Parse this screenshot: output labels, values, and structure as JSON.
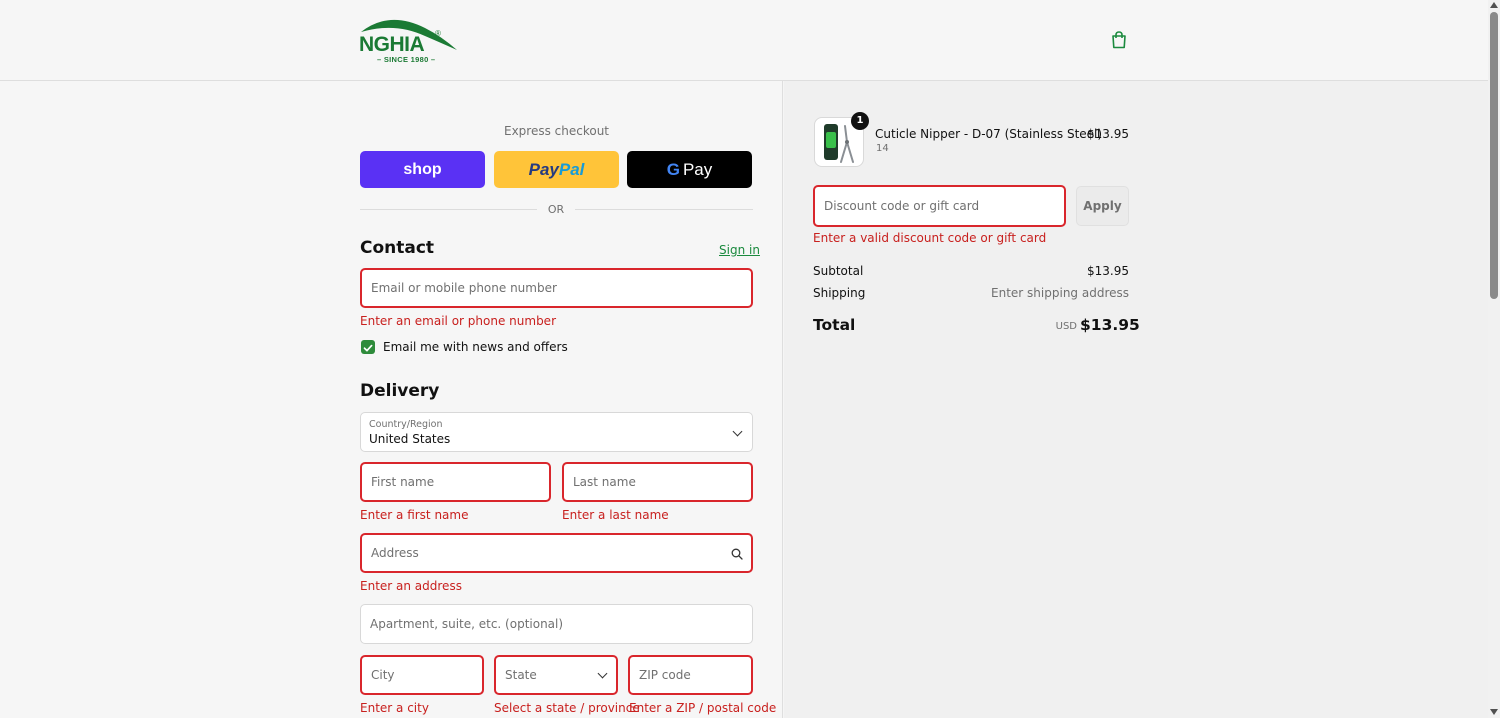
{
  "brand": {
    "name": "NGHIA",
    "tagline": "– SINCE 1980 –",
    "registered": "®",
    "color": "#1b7a34"
  },
  "header": {
    "cart_icon": "shopping-bag-icon"
  },
  "express": {
    "label": "Express checkout",
    "shop_label": "shop",
    "paypal_label_1": "Pay",
    "paypal_label_2": "Pal",
    "gpay_g": "G",
    "gpay_label": "Pay",
    "or_label": "OR"
  },
  "contact": {
    "heading": "Contact",
    "sign_in": "Sign in",
    "email_placeholder": "Email or mobile phone number",
    "email_error": "Enter an email or phone number",
    "newsletter_label": "Email me with news and offers",
    "newsletter_checked": true
  },
  "delivery": {
    "heading": "Delivery",
    "country_label": "Country/Region",
    "country_value": "United States",
    "first_name_placeholder": "First name",
    "first_name_error": "Enter a first name",
    "last_name_placeholder": "Last name",
    "last_name_error": "Enter a last name",
    "address_placeholder": "Address",
    "address_error": "Enter an address",
    "apartment_placeholder": "Apartment, suite, etc. (optional)",
    "city_placeholder": "City",
    "city_error": "Enter a city",
    "state_placeholder": "State",
    "state_error": "Select a state / province",
    "zip_placeholder": "ZIP code",
    "zip_error": "Enter a ZIP / postal code"
  },
  "order": {
    "item": {
      "name": "Cuticle Nipper - D-07 (Stainless Steel)",
      "variant": "14",
      "price": "$13.95",
      "quantity": "1"
    },
    "discount_placeholder": "Discount code or gift card",
    "discount_error": "Enter a valid discount code or gift card",
    "apply_label": "Apply",
    "subtotal_label": "Subtotal",
    "subtotal_value": "$13.95",
    "shipping_label": "Shipping",
    "shipping_value": "Enter shipping address",
    "total_label": "Total",
    "total_currency": "USD",
    "total_value": "$13.95"
  },
  "colors": {
    "error": "#c8201e",
    "accent": "#2e8b3b",
    "shop_pay": "#5a31f4",
    "paypal": "#ffc439"
  }
}
